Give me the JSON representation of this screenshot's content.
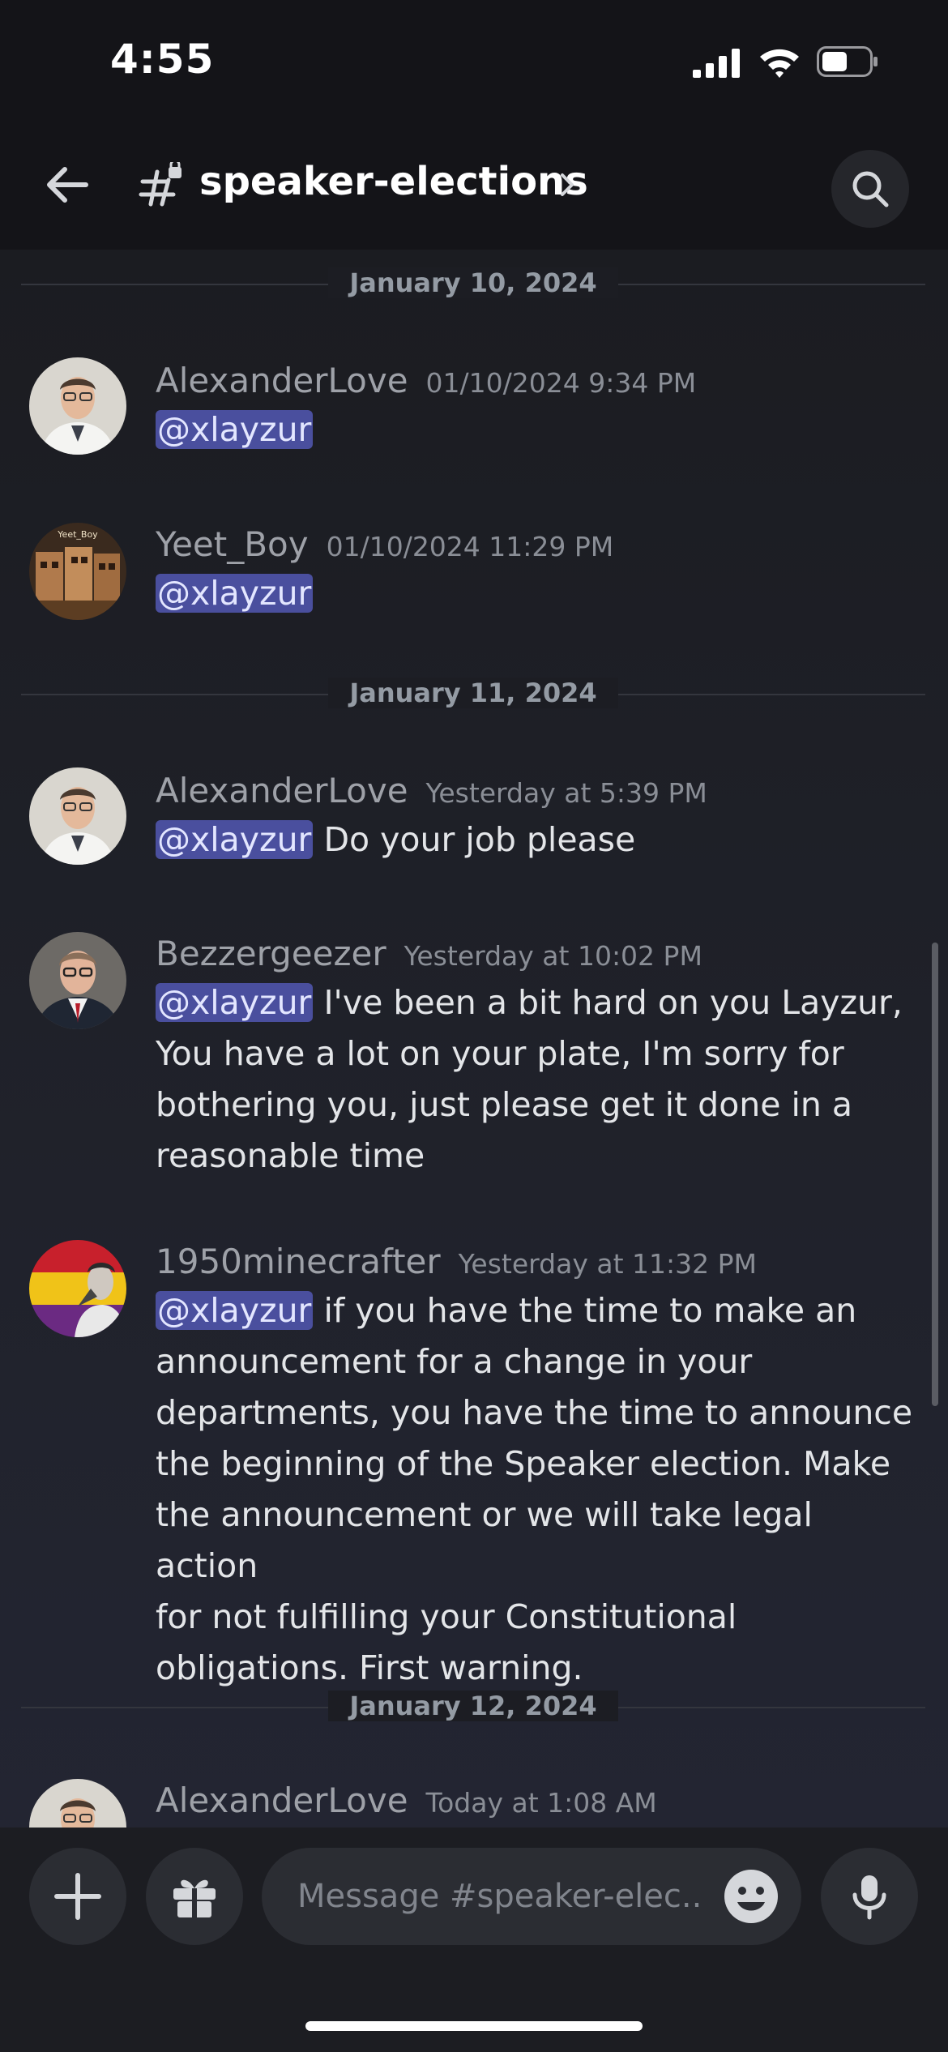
{
  "status_bar": {
    "time": "4:55"
  },
  "header": {
    "channel": "speaker-elections"
  },
  "dividers": [
    {
      "date": "January 10, 2024"
    },
    {
      "date": "January 11, 2024"
    },
    {
      "date": "January 12, 2024"
    }
  ],
  "messages": [
    {
      "user": "AlexanderLove",
      "time": "01/10/2024 9:34 PM",
      "mention": "@xlayzur",
      "text": ""
    },
    {
      "user": "Yeet_Boy",
      "time": "01/10/2024 11:29 PM",
      "mention": "@xlayzur",
      "text": "",
      "avatar_caption": "Yeet_Boy"
    },
    {
      "user": "AlexanderLove",
      "time": "Yesterday at 5:39 PM",
      "mention": "@xlayzur",
      "text": "Do your job please"
    },
    {
      "user": "Bezzergeezer",
      "time": "Yesterday at 10:02 PM",
      "mention": "@xlayzur",
      "lines": [
        "I've been a bit hard on you Layzur,",
        "You have a lot on your plate, I'm sorry for",
        "bothering you, just please get it done in a",
        "reasonable time"
      ]
    },
    {
      "user": "1950minecrafter",
      "time": "Yesterday at 11:32 PM",
      "mention": "@xlayzur",
      "lines": [
        "if you have the time to make an",
        "announcement for a change in your",
        "departments, you have the time to announce",
        "the beginning of the Speaker election. Make",
        "the announcement or we will take legal action",
        "for not fulfilling your Constitutional",
        "obligations. First warning."
      ]
    },
    {
      "user": "AlexanderLove",
      "time": "Today at 1:08 AM"
    }
  ],
  "composer": {
    "placeholder": "Message #speaker-elec..",
    "icons": [
      "plus-icon",
      "gift-icon",
      "emoji-icon",
      "microphone-icon"
    ]
  },
  "colors": {
    "mention_bg": "#4a4f9e",
    "background": "#1a1b20"
  }
}
